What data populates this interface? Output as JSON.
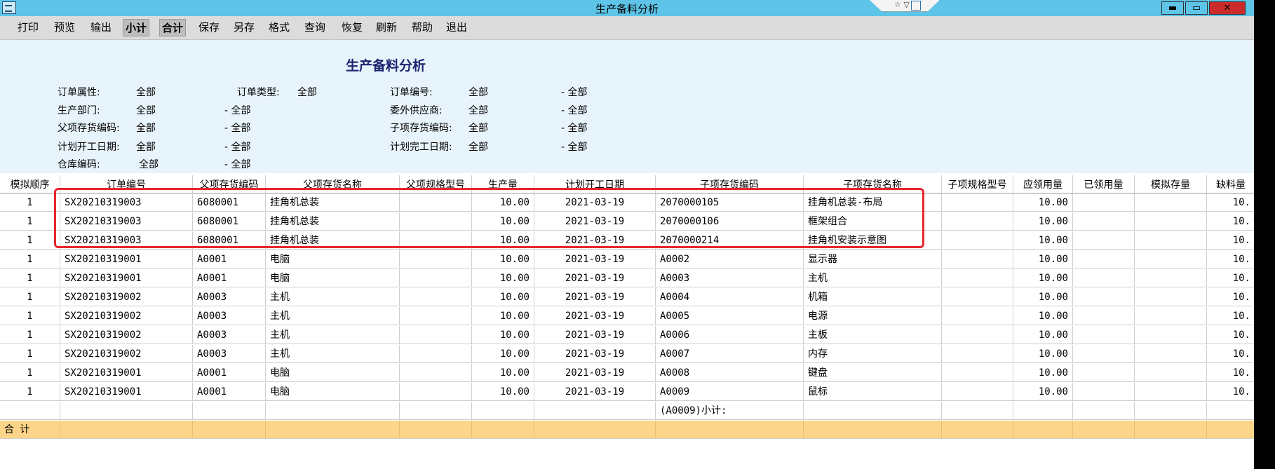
{
  "window": {
    "title": "生产备料分析",
    "widget_text": "☆ ▽",
    "controls": {
      "minimize": "▬",
      "maximize": "▭",
      "close": "✕"
    }
  },
  "toolbar": [
    "打印",
    "预览",
    "输出",
    "小计",
    "合计",
    "保存",
    "另存",
    "格式",
    "查询",
    "恢复",
    "刷新",
    "帮助",
    "退出"
  ],
  "toolbar_pressed": [
    "小计",
    "合计"
  ],
  "report": {
    "title": "生产备料分析",
    "filters": [
      {
        "label": "订单属性:",
        "value": "全部"
      },
      {
        "label": "订单类型:",
        "value": "全部"
      },
      {
        "label": "订单编号:",
        "value": "全部",
        "to": "- 全部"
      },
      {
        "label": "生产部门:",
        "value": "全部",
        "to": "- 全部"
      },
      {
        "label": "委外供应商:",
        "value": "全部",
        "to": "- 全部"
      },
      {
        "label": "父项存货编码:",
        "value": "全部",
        "to": "- 全部"
      },
      {
        "label": "子项存货编码:",
        "value": "全部",
        "to": "- 全部"
      },
      {
        "label": "计划开工日期:",
        "value": "全部",
        "to": "- 全部"
      },
      {
        "label": "计划完工日期:",
        "value": "全部",
        "to": "- 全部"
      },
      {
        "label": "仓库编码:",
        "value": "全部",
        "to": "- 全部"
      }
    ]
  },
  "table": {
    "columns": [
      "模拟顺序",
      "订单编号",
      "父项存货编码",
      "父项存货名称",
      "父项规格型号",
      "生产量",
      "计划开工日期",
      "子项存货编码",
      "子项存货名称",
      "子项规格型号",
      "应领用量",
      "已领用量",
      "模拟存量",
      "缺料量"
    ],
    "rows": [
      [
        "1",
        "SX20210319003",
        "6080001",
        "挂角机总装",
        "",
        "10.00",
        "2021-03-19",
        "2070000105",
        "挂角机总装-布局",
        "",
        "10.00",
        "",
        "",
        "10."
      ],
      [
        "1",
        "SX20210319003",
        "6080001",
        "挂角机总装",
        "",
        "10.00",
        "2021-03-19",
        "2070000106",
        "框架组合",
        "",
        "10.00",
        "",
        "",
        "10."
      ],
      [
        "1",
        "SX20210319003",
        "6080001",
        "挂角机总装",
        "",
        "10.00",
        "2021-03-19",
        "2070000214",
        "挂角机安装示意图",
        "",
        "10.00",
        "",
        "",
        "10."
      ],
      [
        "1",
        "SX20210319001",
        "A0001",
        "电脑",
        "",
        "10.00",
        "2021-03-19",
        "A0002",
        "显示器",
        "",
        "10.00",
        "",
        "",
        "10."
      ],
      [
        "1",
        "SX20210319001",
        "A0001",
        "电脑",
        "",
        "10.00",
        "2021-03-19",
        "A0003",
        "主机",
        "",
        "10.00",
        "",
        "",
        "10."
      ],
      [
        "1",
        "SX20210319002",
        "A0003",
        "主机",
        "",
        "10.00",
        "2021-03-19",
        "A0004",
        "机箱",
        "",
        "10.00",
        "",
        "",
        "10."
      ],
      [
        "1",
        "SX20210319002",
        "A0003",
        "主机",
        "",
        "10.00",
        "2021-03-19",
        "A0005",
        "电源",
        "",
        "10.00",
        "",
        "",
        "10."
      ],
      [
        "1",
        "SX20210319002",
        "A0003",
        "主机",
        "",
        "10.00",
        "2021-03-19",
        "A0006",
        "主板",
        "",
        "10.00",
        "",
        "",
        "10."
      ],
      [
        "1",
        "SX20210319002",
        "A0003",
        "主机",
        "",
        "10.00",
        "2021-03-19",
        "A0007",
        "内存",
        "",
        "10.00",
        "",
        "",
        "10."
      ],
      [
        "1",
        "SX20210319001",
        "A0001",
        "电脑",
        "",
        "10.00",
        "2021-03-19",
        "A0008",
        "键盘",
        "",
        "10.00",
        "",
        "",
        "10."
      ],
      [
        "1",
        "SX20210319001",
        "A0001",
        "电脑",
        "",
        "10.00",
        "2021-03-19",
        "A0009",
        "鼠标",
        "",
        "10.00",
        "",
        "",
        "10."
      ]
    ],
    "subtotal_label": "(A0009)小计:",
    "total_label": "合  计"
  },
  "colors": {
    "titlebar": "#5ec4e8",
    "header_bg": "#e8f4fb",
    "total_row": "#fdd58a",
    "highlight": "#e8262e"
  }
}
